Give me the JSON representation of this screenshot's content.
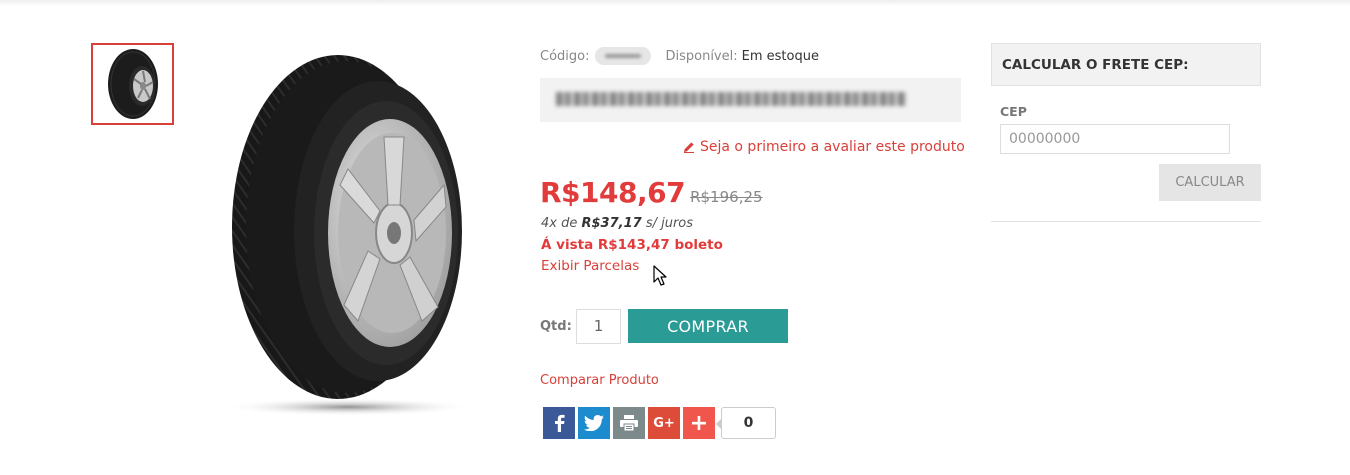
{
  "product": {
    "code_label": "Código:",
    "availability_label": "Disponível:",
    "availability_value": "Em estoque",
    "review_link": "Seja o primeiro a avaliar este produto",
    "price_now": "R$148,67",
    "price_old": "R$196,25",
    "installments_prefix": "4x de",
    "installments_amount": "R$37,17",
    "installments_suffix": "s/ juros",
    "cash_price": "Á vista R$143,47 boleto",
    "show_installments": "Exibir Parcelas",
    "qty_label": "Qtd:",
    "qty_value": "1",
    "buy_button": "COMPRAR",
    "compare_link": "Comparar Produto"
  },
  "share": {
    "count": "0",
    "icons": [
      "facebook-icon",
      "twitter-icon",
      "print-icon",
      "google-plus-icon",
      "plus-icon"
    ],
    "google_plus_label": "G+",
    "plus_label": "+"
  },
  "shipping": {
    "title": "CALCULAR O FRETE CEP:",
    "cep_label": "CEP",
    "cep_placeholder": "00000000",
    "calc_button": "CALCULAR"
  },
  "colors": {
    "accent_red": "#e23b3b",
    "buy_teal": "#2b9b96"
  }
}
